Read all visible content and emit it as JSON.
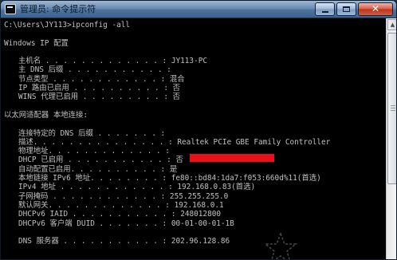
{
  "window": {
    "title": "管理员: 命令提示符",
    "icons": {
      "app": "cmd-icon",
      "minimize": "minimize-icon",
      "maximize": "maximize-icon",
      "close": "close-icon"
    },
    "close_glyph": "✕"
  },
  "console": {
    "colors": {
      "background": "#000000",
      "text": "#c0c0c0",
      "redaction": "#e8101a"
    },
    "prompt_line": "C:\\Users\\JY113>ipconfig -all",
    "header": "Windows IP 配置",
    "host_section": [
      {
        "label": "主机名",
        "dots": " . . . . . . . . . . . . . : ",
        "value": "JY113-PC"
      },
      {
        "label": "主 DNS 后缀",
        "dots": " . . . . . . . . . . . : ",
        "value": ""
      },
      {
        "label": "节点类型",
        "dots": " . . . . . . . . . . . . : ",
        "value": "混合"
      },
      {
        "label": "IP 路由已启用",
        "dots": " . . . . . . . . . . : ",
        "value": "否"
      },
      {
        "label": "WINS 代理已启用",
        "dots": " . . . . . . . . . : ",
        "value": "否"
      }
    ],
    "adapter_header": "以太网适配器 本地连接:",
    "adapter_section": [
      {
        "label": "连接特定的 DNS 后缀",
        "dots": " . . . . . . . : ",
        "value": ""
      },
      {
        "label": "描述",
        "dots": ". . . . . . . . . . . . . . . : ",
        "value": "Realtek PCIe GBE Family Controller"
      },
      {
        "label": "物理地址",
        "dots": ". . . . . . . . . . . . . : ",
        "value": ""
      },
      {
        "label": "DHCP 已启用",
        "dots": " . . . . . . . . . . . : ",
        "value": "否"
      },
      {
        "label": "自动配置已启用",
        "dots": ". . . . . . . . . . : ",
        "value": "是"
      },
      {
        "label": "本地链接 IPv6 地址",
        "dots": ". . . . . . . . : ",
        "value": "fe80::bd84:1da7:f053:660d%11(首选)"
      },
      {
        "label": "IPv4 地址",
        "dots": " . . . . . . . . . . . . : ",
        "value": "192.168.0.83(首选)"
      },
      {
        "label": "子网掩码",
        "dots": " . . . . . . . . . . . . : ",
        "value": "255.255.255.0"
      },
      {
        "label": "默认网关",
        "dots": ". . . . . . . . . . . . . : ",
        "value": "192.168.0.1"
      },
      {
        "label": "DHCPv6 IAID",
        "dots": " . . . . . . . . . . . : ",
        "value": "248012800"
      },
      {
        "label": "DHCPv6 客户端 DUID",
        "dots": " . . . . . . . : ",
        "value": "00-01-00-01-1B"
      },
      {
        "label": "DNS 服务器",
        "dots": " . . . . . . . . . . . : ",
        "value": "202.96.128.86"
      }
    ]
  },
  "scrollbar": {
    "up_icon": "scroll-up-arrow-icon",
    "up_glyph": "▲",
    "thumb_icon": "scroll-thumb",
    "position": 0.0
  },
  "watermark": {
    "icon": "star-watermark-icon"
  }
}
